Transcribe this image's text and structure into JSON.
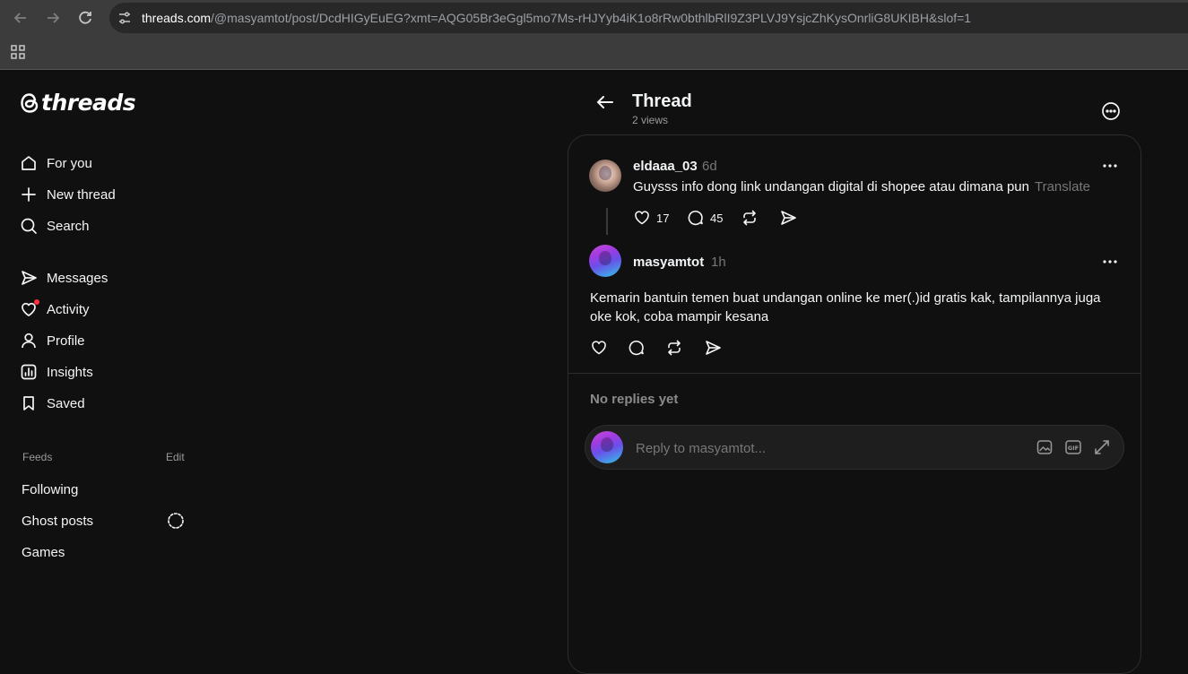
{
  "browser": {
    "url_host": "threads.com",
    "url_path": "/@masyamtot/post/DcdHIGyEuEG?xmt=AQG05Br3eGgl5mo7Ms-rHJYyb4iK1o8rRw0bthlbRlI9Z3PLVJ9YsjcZhKysOnrliG8UKIBH&slof=1"
  },
  "logo": {
    "text": "threads"
  },
  "nav": {
    "for_you": "For you",
    "new_thread": "New thread",
    "search": "Search",
    "messages": "Messages",
    "activity": "Activity",
    "profile": "Profile",
    "insights": "Insights",
    "saved": "Saved"
  },
  "feeds": {
    "label": "Feeds",
    "edit": "Edit",
    "items": [
      "Following",
      "Ghost posts",
      "Games"
    ]
  },
  "header": {
    "title": "Thread",
    "views": "2 views"
  },
  "parent_post": {
    "username": "eldaaa_03",
    "time": "6d",
    "text": "Guysss info dong link undangan digital di shopee atau dimana pun",
    "translate": "Translate",
    "likes": "17",
    "comments": "45"
  },
  "reply_post": {
    "username": "masyamtot",
    "time": "1h",
    "text": "Kemarin bantuin temen buat undangan online ke mer(.)id gratis kak, tampilannya juga oke kok, coba mampir kesana"
  },
  "replies": {
    "empty_text": "No replies yet",
    "placeholder": "Reply to masyamtot..."
  },
  "colors": {
    "background": "#101010",
    "text": "#f3f5f7",
    "secondary": "#777777",
    "notification": "#ff3040"
  }
}
